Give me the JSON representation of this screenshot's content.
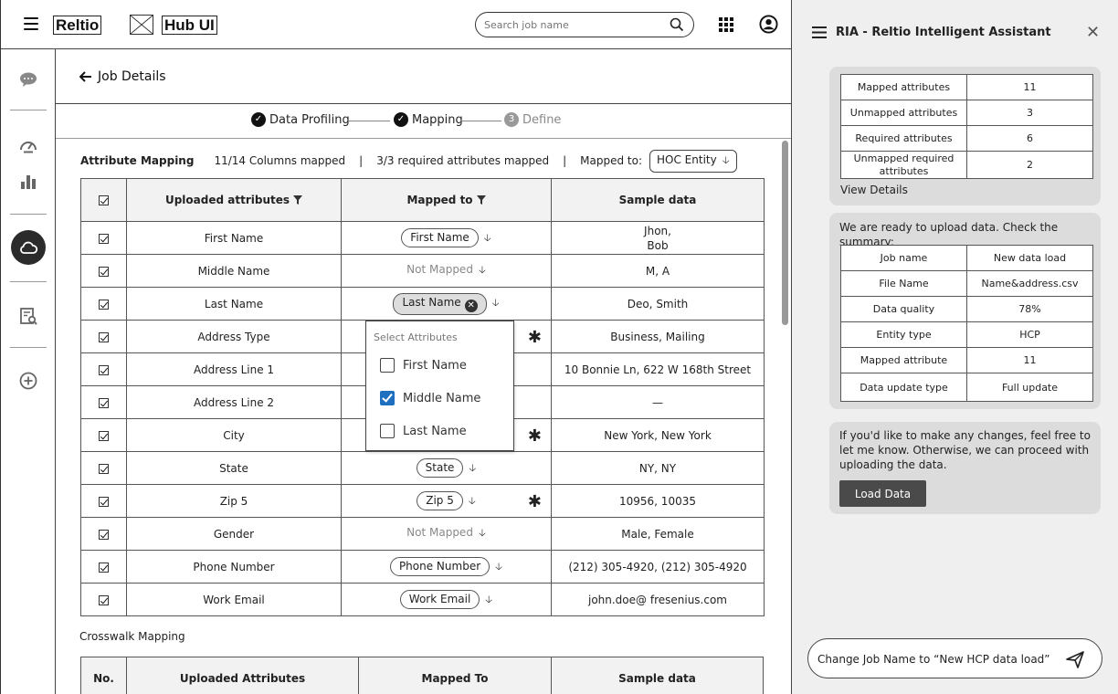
{
  "topbar": {
    "logo": "Reltio",
    "hub": "Hub UI",
    "search_placeholder": "Search job name"
  },
  "page": {
    "back_label": "Job Details"
  },
  "stepper": {
    "steps": [
      {
        "label": "Data Profiling",
        "status": "done"
      },
      {
        "label": "Mapping",
        "status": "done"
      },
      {
        "label": "Define",
        "number": "3",
        "status": "pending"
      }
    ]
  },
  "mapping": {
    "title": "Attribute Mapping",
    "columns_mapped": "11/14 Columns mapped",
    "required_mapped": "3/3 required attributes mapped",
    "sep": "|",
    "mapped_to_label": "Mapped to:",
    "entity": "HOC Entity",
    "headers": [
      "Uploaded attributes",
      "Mapped to",
      "Sample data"
    ],
    "rows": [
      {
        "attr": "First Name",
        "mapped": "First Name",
        "sample": "Jhon,\nBob",
        "required": false
      },
      {
        "attr": "Middle Name",
        "mapped": "Not Mapped",
        "sample": "M, A",
        "required": false
      },
      {
        "attr": "Last Name",
        "mapped": "Last Name",
        "sample": "Deo, Smith",
        "required": false
      },
      {
        "attr": "Address Type",
        "mapped": "",
        "sample": "Business, Mailing",
        "required": true
      },
      {
        "attr": "Address Line 1",
        "mapped": "",
        "sample": "10 Bonnie Ln, 622 W 168th Street",
        "required": false
      },
      {
        "attr": "Address Line 2",
        "mapped": "",
        "sample": "—",
        "required": false
      },
      {
        "attr": "City",
        "mapped": "",
        "sample": "New York, New York",
        "required": true
      },
      {
        "attr": "State",
        "mapped": "State",
        "sample": "NY, NY",
        "required": false
      },
      {
        "attr": "Zip 5",
        "mapped": "Zip 5",
        "sample": "10956, 10035",
        "required": true
      },
      {
        "attr": "Gender",
        "mapped": "Not Mapped",
        "sample": "Male, Female",
        "required": false
      },
      {
        "attr": "Phone Number",
        "mapped": "Phone Number",
        "sample": "(212) 305-4920, (212) 305-4920",
        "required": false
      },
      {
        "attr": "Work Email",
        "mapped": "Work Email",
        "sample": "john.doe@ fresenius.com",
        "required": false
      }
    ]
  },
  "dropdown": {
    "title": "Select Attributes",
    "options": [
      {
        "label": "First Name",
        "checked": false
      },
      {
        "label": "Middle Name",
        "checked": true
      },
      {
        "label": "Last Name",
        "checked": false
      }
    ]
  },
  "crosswalk": {
    "title": "Crosswalk Mapping",
    "headers": [
      "No.",
      "Uploaded Attributes",
      "Mapped To",
      "Sample data"
    ]
  },
  "ria": {
    "title": "RIA - Reltio Intelligent Assistant",
    "stats": [
      {
        "label": "Mapped attributes",
        "value": "11"
      },
      {
        "label": "Unmapped attributes",
        "value": "3"
      },
      {
        "label": "Required attributes",
        "value": "6"
      },
      {
        "label": "Unmapped required attributes",
        "value": "2"
      }
    ],
    "view_details": "View Details",
    "ready_text": "We are ready to upload data. Check the summary:",
    "summary": [
      {
        "label": "Job name",
        "value": "New data load"
      },
      {
        "label": "File Name",
        "value": "Name&address.csv"
      },
      {
        "label": "Data quality",
        "value": "78%"
      },
      {
        "label": "Entity type",
        "value": "HCP"
      },
      {
        "label": "Mapped attribute",
        "value": "11"
      },
      {
        "label": "Data update type",
        "value": "Full update"
      }
    ],
    "proceed_text": "If you'd like to make any changes, feel free to let me know. Otherwise, we can proceed with uploading the data.",
    "load_button": "Load Data",
    "input_value": "Change Job Name to “New HCP data load”"
  }
}
